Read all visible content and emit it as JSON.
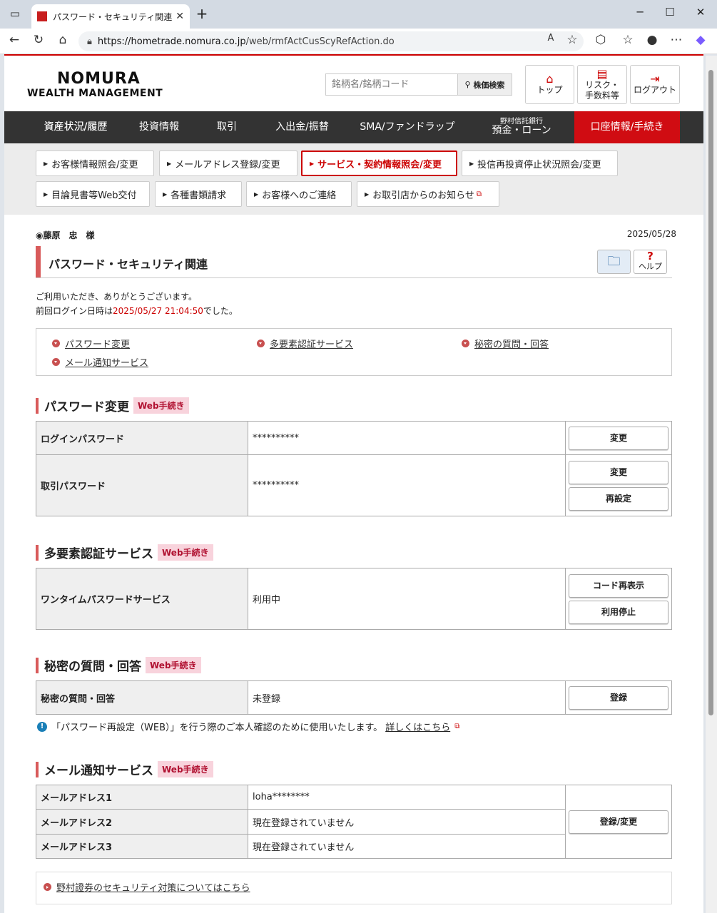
{
  "browser": {
    "tab_title": "パスワード・セキュリティ関連 | 野村證券",
    "url_host": "https://hometrade.nomura.co.jp",
    "url_path": "/web/rmfActCusScyRefAction.do"
  },
  "header": {
    "logo_line1": "NOMURA",
    "logo_line2": "WEALTH MANAGEMENT",
    "search_placeholder": "銘柄名/銘柄コード",
    "search_button": "株価検索",
    "top_label": "トップ",
    "risk_label1": "リスク・",
    "risk_label2": "手数料等",
    "logout_label": "ログアウト"
  },
  "mainnav": [
    {
      "label": "資産状況/履歴"
    },
    {
      "label": "投資情報"
    },
    {
      "label": "取引"
    },
    {
      "label": "入出金/振替"
    },
    {
      "label": "SMA/ファンドラップ"
    },
    {
      "label": "預金・ローン",
      "small": "野村信託銀行"
    },
    {
      "label": "口座情報/手続き"
    }
  ],
  "subnav": [
    "お客様情報照会/変更",
    "メールアドレス登録/変更",
    "サービス・契約情報照会/変更",
    "投信再投資停止状況照会/変更",
    "目論見書等Web交付",
    "各種書類請求",
    "お客様へのご連絡",
    "お取引店からのお知らせ"
  ],
  "user_name": "藤原　忠　様",
  "date": "2025/05/28",
  "page_title": "パスワード・セキュリティ関連",
  "help_label": "ヘルプ",
  "greeting1": "ご利用いただき、ありがとうございます。",
  "greeting2_pre": "前回ログイン日時は",
  "last_login": "2025/05/27 21:04:50",
  "greeting2_post": "でした。",
  "links": [
    "パスワード変更",
    "多要素認証サービス",
    "秘密の質問・回答",
    "メール通知サービス"
  ],
  "web_badge": "Web手続き",
  "password": {
    "title": "パスワード変更",
    "login_label": "ログインパスワード",
    "login_value": "**********",
    "trade_label": "取引パスワード",
    "trade_value": "**********",
    "change": "変更",
    "reset": "再設定"
  },
  "mfa": {
    "title": "多要素認証サービス",
    "label": "ワンタイムパスワードサービス",
    "value": "利用中",
    "redisplay": "コード再表示",
    "stop": "利用停止"
  },
  "secret": {
    "title": "秘密の質問・回答",
    "label": "秘密の質問・回答",
    "value": "未登録",
    "register": "登録",
    "note": "「パスワード再設定（WEB）」を行う際のご本人確認のために使用いたします。",
    "note_link": "詳しくはこちら"
  },
  "mail": {
    "title": "メール通知サービス",
    "rows": [
      {
        "label": "メールアドレス1",
        "value": "loha********"
      },
      {
        "label": "メールアドレス2",
        "value": "現在登録されていません"
      },
      {
        "label": "メールアドレス3",
        "value": "現在登録されていません"
      }
    ],
    "button": "登録/変更"
  },
  "footer_link": "野村證券のセキュリティ対策についてはこちら"
}
